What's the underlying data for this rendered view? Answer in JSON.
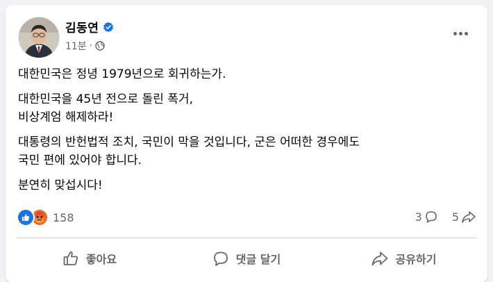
{
  "post": {
    "author": "김동연",
    "time": "11분",
    "separator": "·",
    "paragraphs": [
      "대한민국은 정녕 1979년으로 회귀하는가.",
      "대한민국을 45년 전으로 돌린 폭거,\n비상계엄 해제하라!",
      "대통령의 반헌법적 조치, 국민이 막을 것입니다, 군은 어떠한 경우에도\n국민 편에 있어야 합니다.",
      "분연히 맞섭시다!"
    ]
  },
  "stats": {
    "reaction_count": "158",
    "comment_count": "3",
    "share_count": "5"
  },
  "actions": {
    "like_label": "좋아요",
    "comment_label": "댓글 달기",
    "share_label": "공유하기"
  },
  "icons": {
    "verified": "verified-badge-icon",
    "privacy": "globe-icon",
    "more": "more-options-icon",
    "like_reaction": "thumbs-up-icon",
    "angry_reaction": "angry-face-icon",
    "comment": "comment-bubble-icon",
    "share": "share-arrow-icon"
  },
  "colors": {
    "brand_blue": "#1b74e4",
    "angry_orange": "#e66b26",
    "secondary_text": "#65676b",
    "background": "#f0f2f5"
  }
}
